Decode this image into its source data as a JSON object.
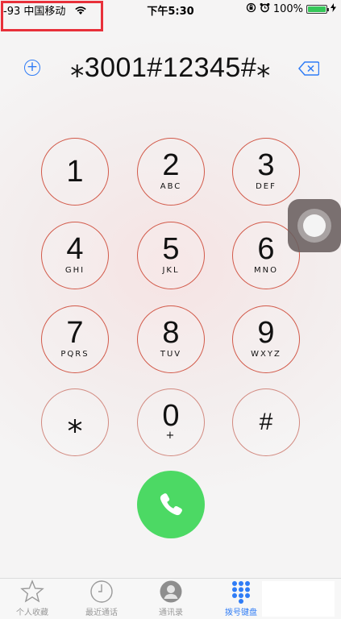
{
  "status": {
    "carrier": "-93 中国移动",
    "time": "下午5:30",
    "battery": "100%",
    "battery_level": 1.0
  },
  "dialer": {
    "number": "⁎3001#12345#⁎",
    "add_icon": "plus-circle-icon",
    "delete_icon": "backspace-icon"
  },
  "keys": [
    {
      "digit": "1",
      "letters": ""
    },
    {
      "digit": "2",
      "letters": "ABC"
    },
    {
      "digit": "3",
      "letters": "DEF"
    },
    {
      "digit": "4",
      "letters": "GHI"
    },
    {
      "digit": "5",
      "letters": "JKL"
    },
    {
      "digit": "6",
      "letters": "MNO"
    },
    {
      "digit": "7",
      "letters": "PQRS"
    },
    {
      "digit": "8",
      "letters": "TUV"
    },
    {
      "digit": "9",
      "letters": "WXYZ"
    },
    {
      "digit": "⁎",
      "letters": ""
    },
    {
      "digit": "0",
      "letters": "+"
    },
    {
      "digit": "#",
      "letters": ""
    }
  ],
  "call_icon": "phone-icon",
  "tabs": [
    {
      "label": "个人收藏",
      "icon": "star-icon",
      "active": false
    },
    {
      "label": "最近通话",
      "icon": "clock-icon",
      "active": false
    },
    {
      "label": "通讯录",
      "icon": "contact-icon",
      "active": false
    },
    {
      "label": "拨号键盘",
      "icon": "keypad-icon",
      "active": true
    }
  ],
  "colors": {
    "accent": "#2f7cf6",
    "key_ring": "#d25a4a",
    "call_green": "#4cd964",
    "highlight_box": "#e8303a"
  }
}
